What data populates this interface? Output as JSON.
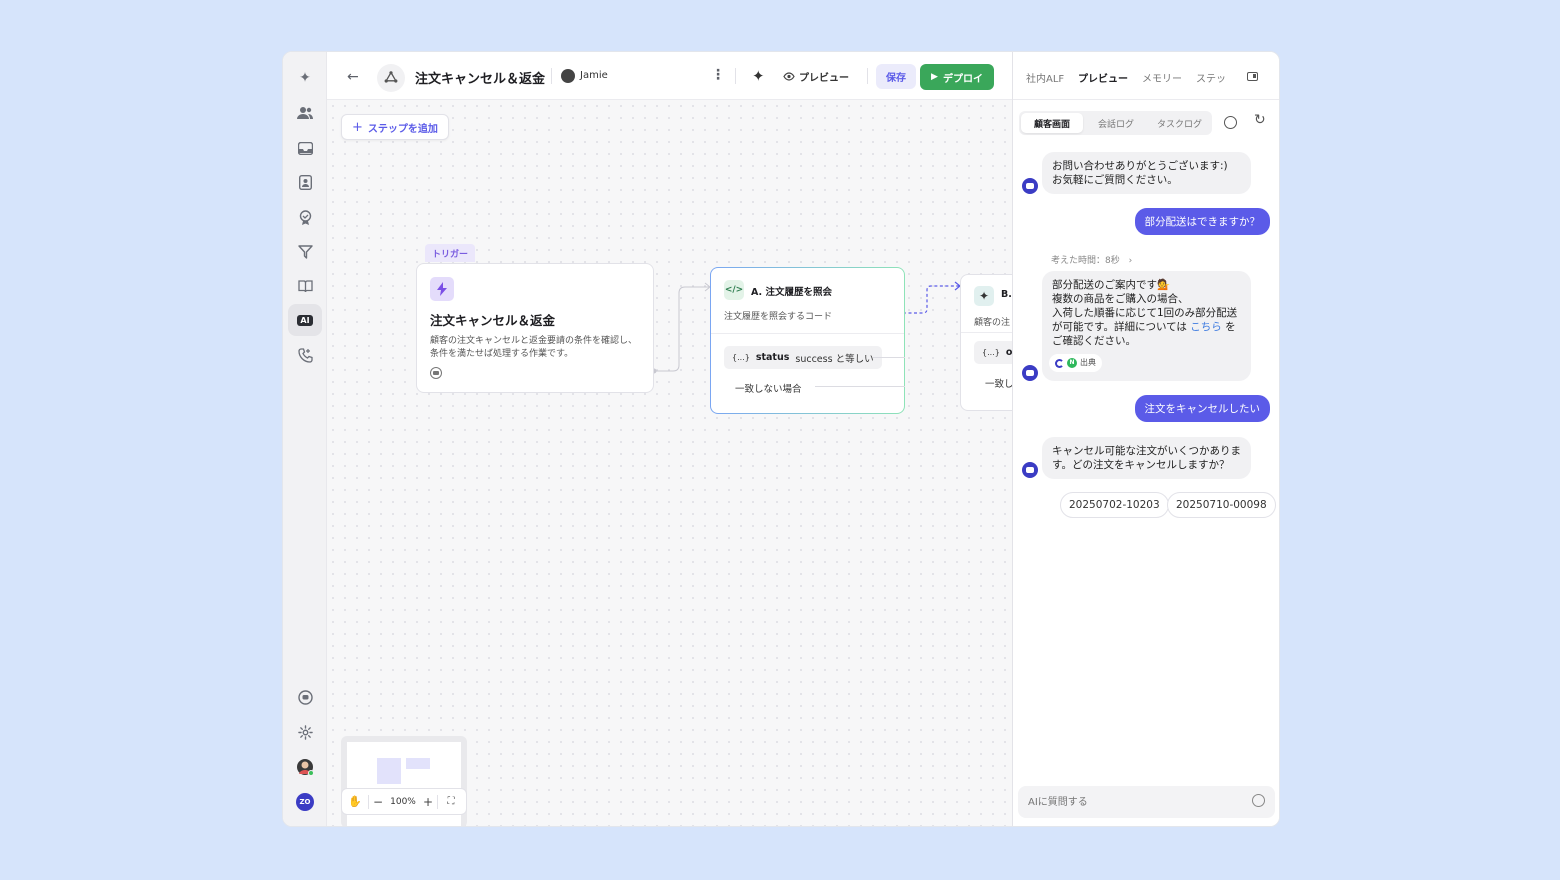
{
  "header": {
    "title": "注文キャンセル＆返金",
    "author": "Jamie",
    "preview_label": "プレビュー",
    "save_label": "保存",
    "deploy_label": "デプロイ"
  },
  "canvas": {
    "add_step_label": "ステップを追加",
    "zoom": "100%",
    "trigger": {
      "tag": "トリガー",
      "title": "注文キャンセル＆返金",
      "description": "顧客の注文キャンセルと返金要請の条件を確認し、条件を満たせば処理する作業です。"
    },
    "step_a": {
      "title": "A. 注文履歴を照会",
      "description": "注文履歴を照会するコード",
      "condition_token": "{...}",
      "condition_var": "status",
      "condition_rest": "success と等しい",
      "else_label": "一致しない場合"
    },
    "step_b": {
      "title": "B.",
      "description": "顧客の注",
      "condition_token": "{...}",
      "condition_var": "ord",
      "else_label": "一致し"
    }
  },
  "panel": {
    "tabs": [
      "社内ALF",
      "プレビュー",
      "メモリー",
      "ステッ"
    ],
    "subtabs": [
      "顧客画面",
      "会話ログ",
      "タスクログ"
    ],
    "messages": {
      "bot1_line1": "お問い合わせありがとうございます:)",
      "bot1_line2": "お気軽にご質問ください。",
      "user1": "部分配送はできますか？",
      "thinking": "考えた時間：8秒",
      "bot2_line1": "部分配送のご案内です💁",
      "bot2_line2": "複数の商品をご購入の場合、",
      "bot2_line3": "入荷した順番に応じて1回のみ部分配送",
      "bot2_line4a": "が可能です。詳細については ",
      "bot2_link": "こちら",
      "bot2_line4b": " を",
      "bot2_line5": "ご確認ください。",
      "source_label": "出典",
      "user2": "注文をキャンセルしたい",
      "bot3_line1": "キャンセル可能な注文がいくつかありま",
      "bot3_line2": "す。どの注文をキャンセルしますか？"
    },
    "order_chips": [
      "20250702-10203",
      "20250710-00098"
    ],
    "input_placeholder": "AIに質問する"
  },
  "colors": {
    "accent": "#5b5be8",
    "deploy": "#3aa75a",
    "background": "#d6e4fb"
  }
}
